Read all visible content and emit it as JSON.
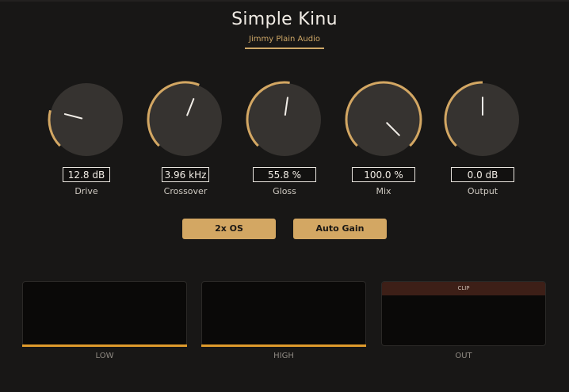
{
  "plugin": {
    "title": "Simple Kinu",
    "vendor": "Jimmy Plain Audio"
  },
  "colors": {
    "accent": "#d3a763",
    "meter_fill": "#de9a2c",
    "knob_body": "#363330",
    "background": "#181716"
  },
  "knobs": [
    {
      "id": "drive",
      "label": "Drive",
      "value": "12.8 dB",
      "position": 0.22
    },
    {
      "id": "crossover",
      "label": "Crossover",
      "value": "3.96 kHz",
      "position": 0.58
    },
    {
      "id": "gloss",
      "label": "Gloss",
      "value": "55.8 %",
      "position": 0.53
    },
    {
      "id": "mix",
      "label": "Mix",
      "value": "100.0 %",
      "position": 1.0
    },
    {
      "id": "output",
      "label": "Output",
      "value": "0.0 dB",
      "position": 0.5
    }
  ],
  "buttons": {
    "oversampling": "2x OS",
    "auto_gain": "Auto Gain"
  },
  "meters": [
    {
      "label": "LOW",
      "level": 1.0
    },
    {
      "label": "HIGH",
      "level": 1.0
    },
    {
      "label": "OUT",
      "clip_label": "CLIP",
      "level": 0.0
    }
  ]
}
